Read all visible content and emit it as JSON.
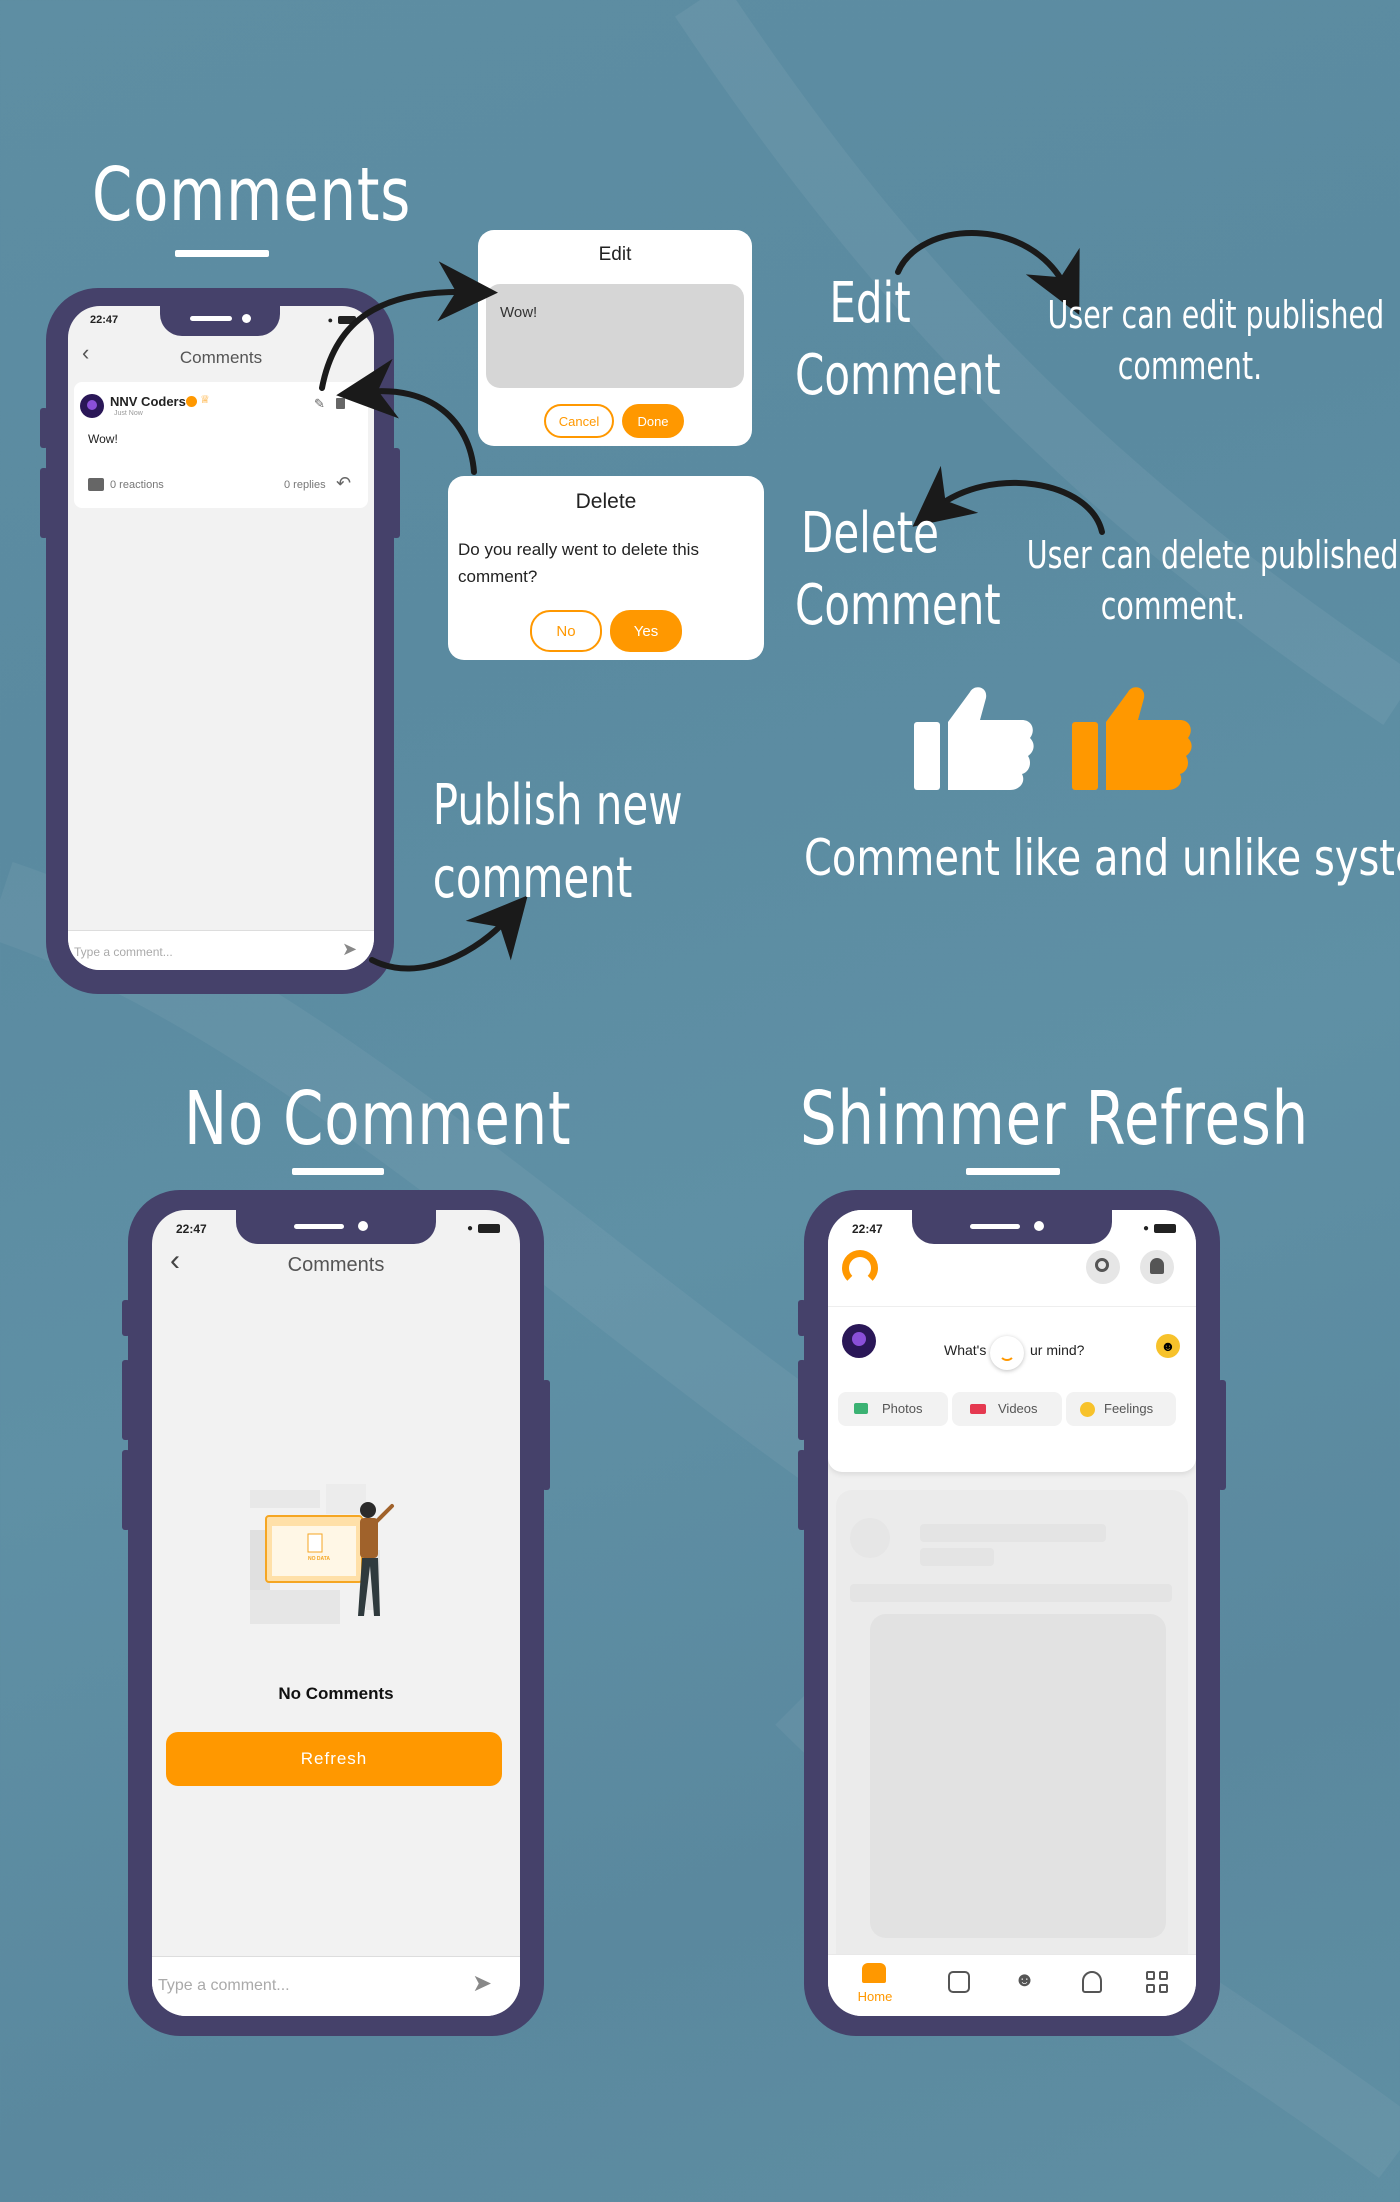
{
  "headings": {
    "comments": "Comments",
    "no_comment": "No Comment",
    "shimmer_refresh": "Shimmer Refresh"
  },
  "captions": {
    "edit_title": "Edit\nComment",
    "edit_desc": "User can edit published\ncomment.",
    "delete_title": "Delete\nComment",
    "delete_desc": "User can delete published\ncomment.",
    "publish": "Publish new\ncomment",
    "like_system": "Comment like and unlike system"
  },
  "phone1": {
    "time": "22:47",
    "title": "Comments",
    "comment": {
      "user": "NNV Coders",
      "time": "Just Now",
      "text": "Wow!",
      "reactions": "0 reactions",
      "replies": "0 replies"
    },
    "input_placeholder": "Type a comment..."
  },
  "edit_dialog": {
    "title": "Edit",
    "value": "Wow!",
    "cancel": "Cancel",
    "done": "Done"
  },
  "delete_dialog": {
    "title": "Delete",
    "message": "Do you really went to delete this comment?",
    "no": "No",
    "yes": "Yes"
  },
  "phone2": {
    "time": "22:47",
    "title": "Comments",
    "illustration_text": "NO DATA",
    "empty_text": "No Comments",
    "refresh": "Refresh",
    "input_placeholder": "Type a comment..."
  },
  "phone3": {
    "time": "22:47",
    "prompt_left": "What's",
    "prompt_right": "ur mind?",
    "photos": "Photos",
    "videos": "Videos",
    "feelings": "Feelings",
    "nav_home": "Home"
  },
  "colors": {
    "accent": "#ff9800",
    "phone_frame": "#45416a",
    "background": "#5e8ea3"
  }
}
